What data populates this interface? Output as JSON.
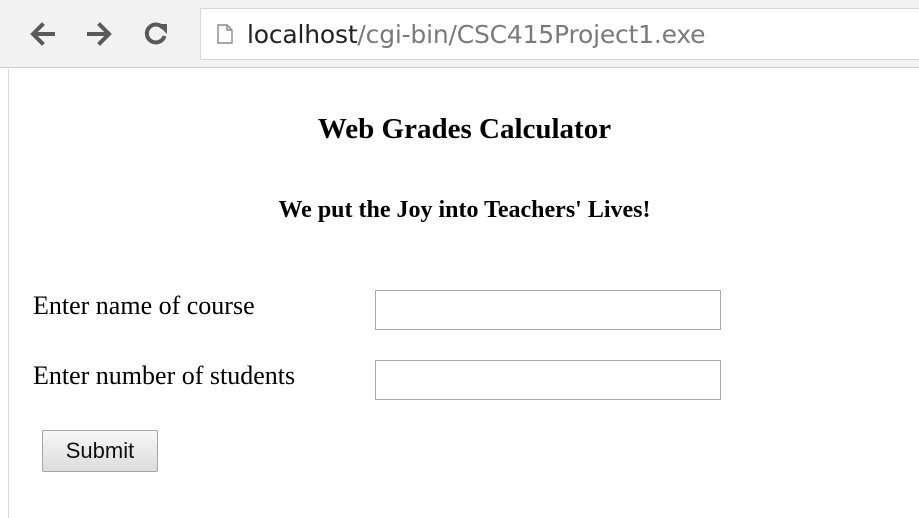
{
  "browser": {
    "url_host": "localhost",
    "url_path": "/cgi-bin/CSC415Project1.exe",
    "icons": {
      "back": "arrow-left-icon",
      "forward": "arrow-right-icon",
      "reload": "reload-icon",
      "page": "page-icon"
    }
  },
  "page": {
    "title": "Web Grades Calculator",
    "subtitle": "We put the Joy into Teachers' Lives!",
    "form": {
      "course_label": "Enter name of course",
      "course_value": "",
      "students_label": "Enter number of students",
      "students_value": "",
      "submit_label": "Submit"
    }
  },
  "colors": {
    "chrome_bg": "#f2f2f2",
    "url_host": "#222222",
    "url_path": "#7a7a7a",
    "icon": "#5a5a5a"
  }
}
